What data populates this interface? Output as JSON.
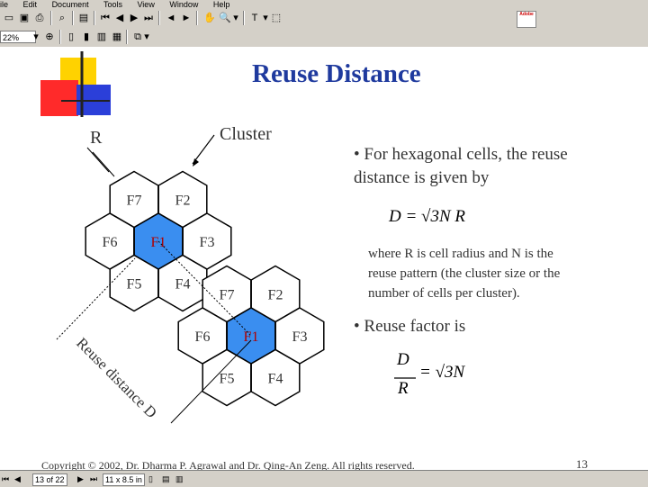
{
  "menu": [
    "ile",
    "Edit",
    "Document",
    "Tools",
    "View",
    "Window",
    "Help"
  ],
  "toolbar": {
    "zoom_value": "22%",
    "adobe_label": "Adobe"
  },
  "slide": {
    "title": "Reuse Distance",
    "label_R": "R",
    "label_cluster": "Cluster",
    "bullet1_line1": "• For hexagonal cells, the reuse",
    "bullet1_line2": "distance is given by",
    "formula1": "D = √3N R",
    "where_line1": "where R is cell radius and N is the",
    "where_line2": "reuse pattern (the cluster size or the",
    "where_line3": "number of cells per cluster).",
    "bullet2": "• Reuse factor is",
    "formula2_num": "D",
    "formula2_den": "R",
    "formula2_rhs": "= √3N",
    "reuse_distance_label": "Reuse distance D",
    "copyright": "Copyright © 2002, Dr. Dharma P. Agrawal and Dr. Qing-An Zeng. All rights reserved.",
    "page_number": "13",
    "cluster1": [
      {
        "label": "F7",
        "highlight": false
      },
      {
        "label": "F2",
        "highlight": false
      },
      {
        "label": "F6",
        "highlight": false
      },
      {
        "label": "F1",
        "highlight": true
      },
      {
        "label": "F3",
        "highlight": false
      },
      {
        "label": "F5",
        "highlight": false
      },
      {
        "label": "F4",
        "highlight": false
      }
    ],
    "cluster2": [
      {
        "label": "F7",
        "highlight": false
      },
      {
        "label": "F2",
        "highlight": false
      },
      {
        "label": "F6",
        "highlight": false
      },
      {
        "label": "F1",
        "highlight": true
      },
      {
        "label": "F3",
        "highlight": false
      },
      {
        "label": "F5",
        "highlight": false
      },
      {
        "label": "F4",
        "highlight": false
      }
    ],
    "highlight_color": "#3a8ef0"
  },
  "statusbar": {
    "page_field": "13 of 22",
    "size_field": "11 x 8.5 in"
  }
}
